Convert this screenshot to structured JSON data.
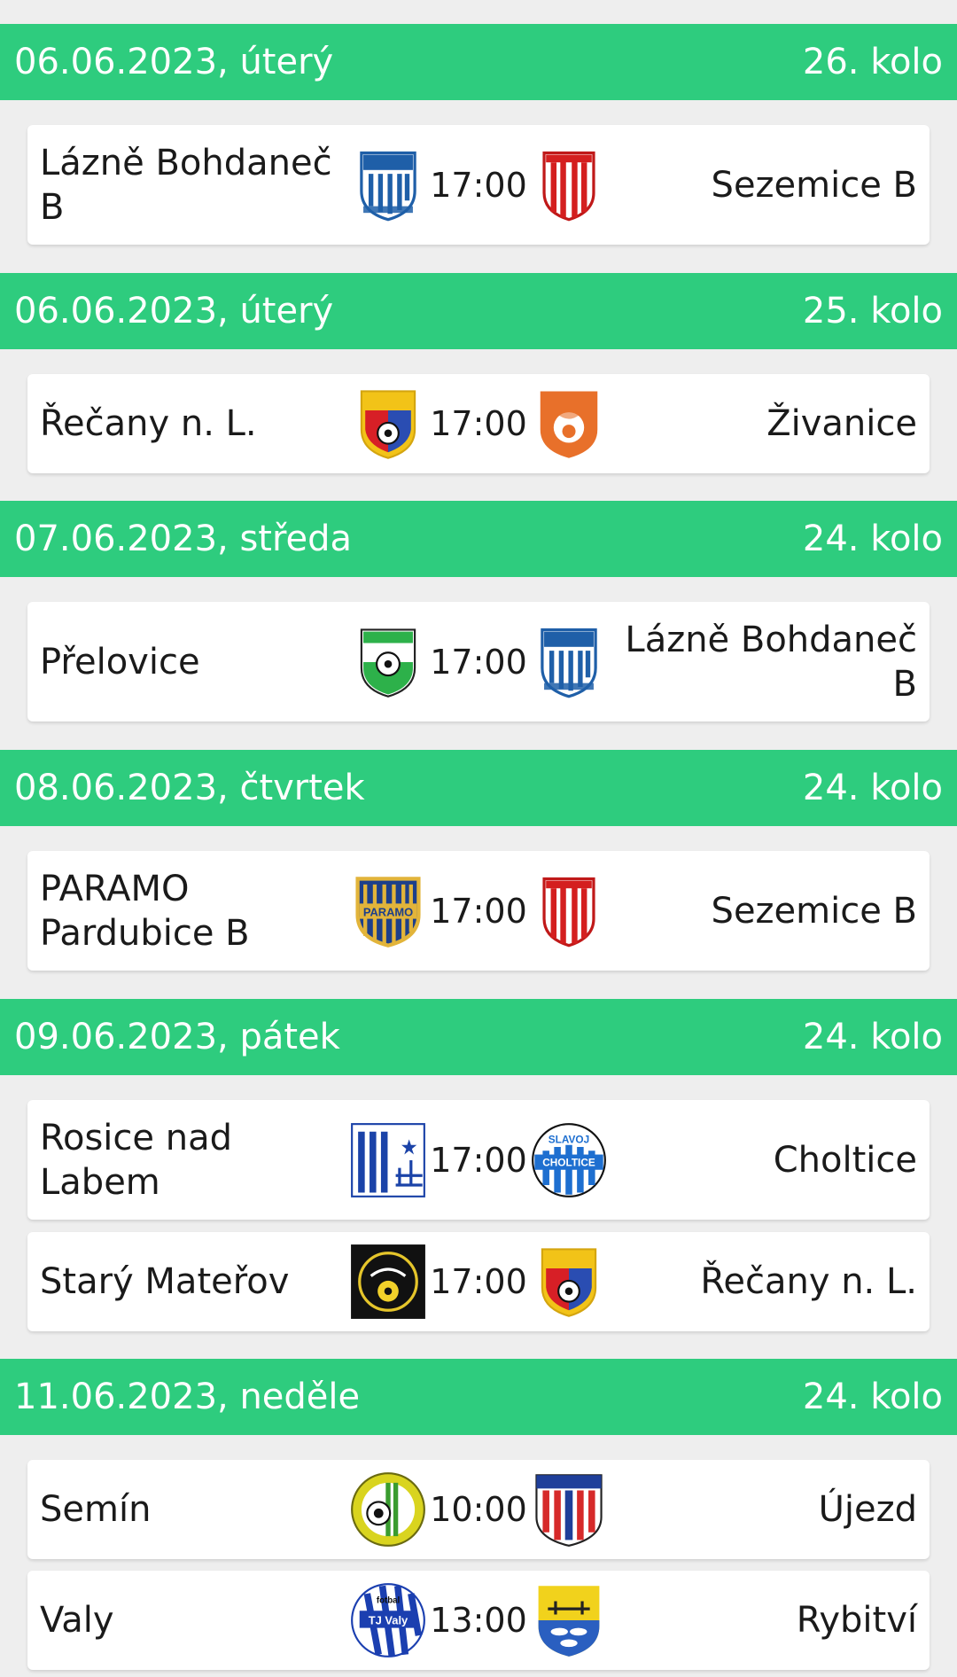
{
  "theme": {
    "header_color": "#2ecc7e",
    "card_color": "#ffffff",
    "background": "#eeeeee"
  },
  "days": [
    {
      "date": "06.06.2023, úterý",
      "round": "26. kolo",
      "matches": [
        {
          "home": "Lázně Bohdaneč B",
          "time": "17:00",
          "away": "Sezemice B",
          "home_crest": "bohdanec-crest-icon",
          "away_crest": "sezemice-crest-icon"
        }
      ]
    },
    {
      "date": "06.06.2023, úterý",
      "round": "25. kolo",
      "matches": [
        {
          "home": "Řečany n. L.",
          "time": "17:00",
          "away": "Živanice",
          "home_crest": "recany-crest-icon",
          "away_crest": "zivanice-crest-icon"
        }
      ]
    },
    {
      "date": "07.06.2023, středa",
      "round": "24. kolo",
      "matches": [
        {
          "home": "Přelovice",
          "time": "17:00",
          "away": "Lázně Bohdaneč B",
          "home_crest": "prelovice-crest-icon",
          "away_crest": "bohdanec-crest-icon"
        }
      ]
    },
    {
      "date": "08.06.2023, čtvrtek",
      "round": "24. kolo",
      "matches": [
        {
          "home": "PARAMO Pardubice B",
          "time": "17:00",
          "away": "Sezemice B",
          "home_crest": "paramo-crest-icon",
          "away_crest": "sezemice-crest-icon"
        }
      ]
    },
    {
      "date": "09.06.2023, pátek",
      "round": "24. kolo",
      "matches": [
        {
          "home": "Rosice nad Labem",
          "time": "17:00",
          "away": "Choltice",
          "home_crest": "rosice-crest-icon",
          "away_crest": "choltice-crest-icon"
        },
        {
          "home": "Starý Mateřov",
          "time": "17:00",
          "away": "Řečany n. L.",
          "home_crest": "stary-materov-crest-icon",
          "away_crest": "recany-crest-icon"
        }
      ]
    },
    {
      "date": "11.06.2023, neděle",
      "round": "24. kolo",
      "matches": [
        {
          "home": "Semín",
          "time": "10:00",
          "away": "Újezd",
          "home_crest": "semin-crest-icon",
          "away_crest": "ujezd-crest-icon"
        },
        {
          "home": "Valy",
          "time": "13:00",
          "away": "Rybitví",
          "home_crest": "valy-crest-icon",
          "away_crest": "rybitvi-crest-icon"
        }
      ]
    }
  ],
  "crest_texts": {
    "paramo": "PARAMO",
    "choltice_top": "SLAVOJ",
    "choltice_bottom": "CHOLTICE",
    "valy_top": "fotbal",
    "valy_bottom": "TJ Valy"
  }
}
